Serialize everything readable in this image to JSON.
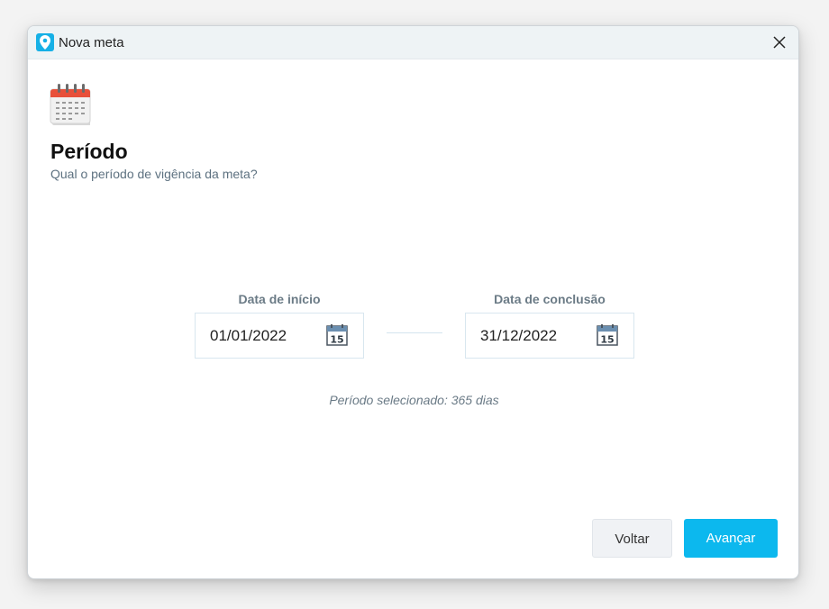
{
  "window": {
    "title": "Nova meta",
    "app_icon": "location-pin-icon",
    "close_icon": "close-icon"
  },
  "header": {
    "icon": "calendar-icon",
    "title": "Período",
    "subtitle": "Qual o período de vigência da meta?"
  },
  "start": {
    "label": "Data de início",
    "value": "01/01/2022",
    "icon": "calendar-15-icon"
  },
  "end": {
    "label": "Data de conclusão",
    "value": "31/12/2022",
    "icon": "calendar-15-icon"
  },
  "calendar_day": "15",
  "period_text": "Período selecionado: 365 dias",
  "buttons": {
    "back": "Voltar",
    "next": "Avançar"
  },
  "colors": {
    "accent": "#0cb8ee",
    "titlebar": "#eef3f5",
    "calendar_red": "#e8503a"
  }
}
